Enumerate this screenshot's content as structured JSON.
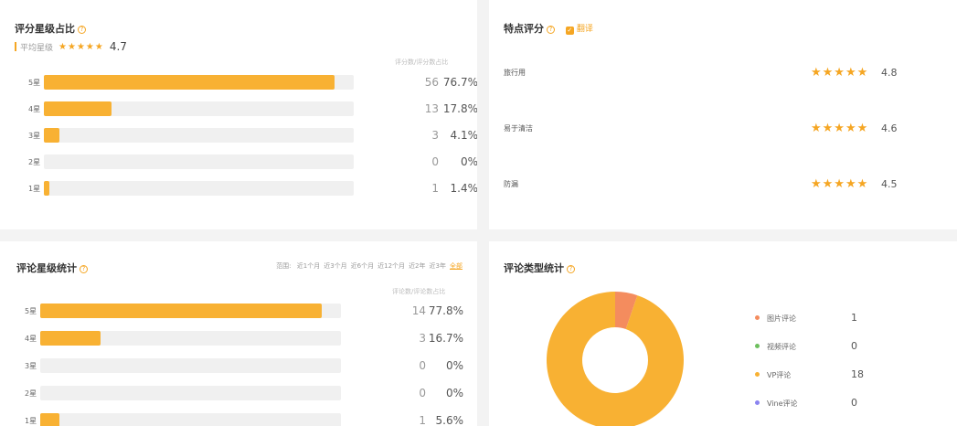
{
  "rating_share": {
    "title": "评分星级占比",
    "avg_label": "平均星级",
    "avg_stars": "★★★★★",
    "avg_value": "4.7",
    "col_header": "评分数/评分数占比",
    "rows": [
      {
        "label": "5星",
        "count": "56",
        "pct": "76.7%",
        "fraction": 0.937
      },
      {
        "label": "4星",
        "count": "13",
        "pct": "17.8%",
        "fraction": 0.218
      },
      {
        "label": "3星",
        "count": "3",
        "pct": "4.1%",
        "fraction": 0.05
      },
      {
        "label": "2星",
        "count": "0",
        "pct": "0%",
        "fraction": 0
      },
      {
        "label": "1星",
        "count": "1",
        "pct": "1.4%",
        "fraction": 0.017
      }
    ]
  },
  "feature_rating": {
    "title": "特点评分",
    "translate_label": "翻译",
    "translate_checked": true,
    "items": [
      {
        "name": "旅行用",
        "stars": "★★★★★",
        "score": "4.8"
      },
      {
        "name": "易于清洁",
        "stars": "★★★★★",
        "score": "4.6"
      },
      {
        "name": "防漏",
        "stars": "★★★★★",
        "score": "4.5"
      }
    ]
  },
  "review_stats": {
    "title": "评论星级统计",
    "range_label": "范围:",
    "ranges": [
      "近1个月",
      "近3个月",
      "近6个月",
      "近12个月",
      "近2年",
      "近3年",
      "全部"
    ],
    "active_range": "全部",
    "col_header": "评论数/评论数占比",
    "rows": [
      {
        "label": "5星",
        "count": "14",
        "pct": "77.8%",
        "fraction": 0.937
      },
      {
        "label": "4星",
        "count": "3",
        "pct": "16.7%",
        "fraction": 0.2
      },
      {
        "label": "3星",
        "count": "0",
        "pct": "0%",
        "fraction": 0
      },
      {
        "label": "2星",
        "count": "0",
        "pct": "0%",
        "fraction": 0
      },
      {
        "label": "1星",
        "count": "1",
        "pct": "5.6%",
        "fraction": 0.065
      }
    ]
  },
  "review_types": {
    "title": "评论类型统计",
    "legend": [
      {
        "name": "图片评论",
        "value": "1",
        "color": "#f48c5e"
      },
      {
        "name": "视频评论",
        "value": "0",
        "color": "#6dbf5e"
      },
      {
        "name": "VP评论",
        "value": "18",
        "color": "#f8b133"
      },
      {
        "name": "Vine评论",
        "value": "0",
        "color": "#8b84f0"
      }
    ]
  },
  "colors": {
    "accent": "#f5a623",
    "bar": "#f8b133",
    "track": "#f0f0f0"
  }
}
